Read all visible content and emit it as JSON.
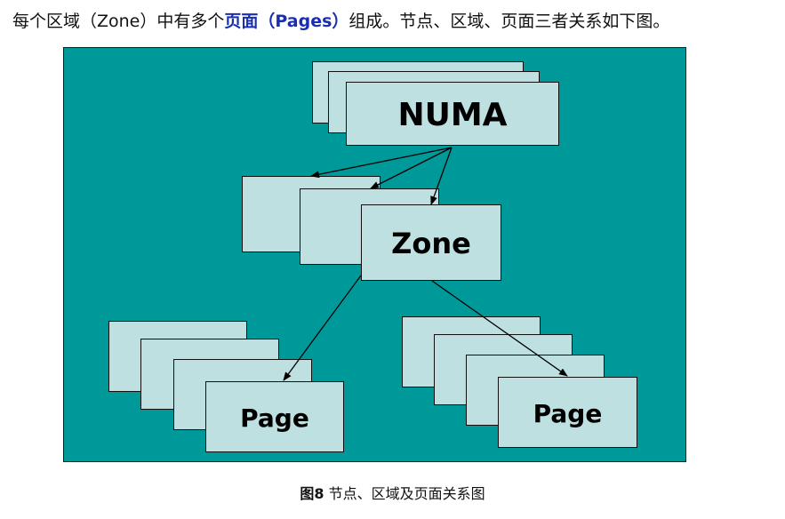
{
  "intro": {
    "part1": "每个区域（Zone）中有多个",
    "highlight": "页面（Pages）",
    "part2": "组成。节点、区域、页面三者关系如下图。"
  },
  "diagram": {
    "numa_label": "NUMA",
    "zone_label": "Zone",
    "page_left_label": "Page",
    "page_right_label": "Page",
    "colors": {
      "background": "#009999",
      "box_fill": "#bfe0e0",
      "border": "#111111",
      "highlight_text": "#1a2fb0"
    }
  },
  "caption": {
    "fig_label": "图8",
    "text": "节点、区域及页面关系图"
  }
}
